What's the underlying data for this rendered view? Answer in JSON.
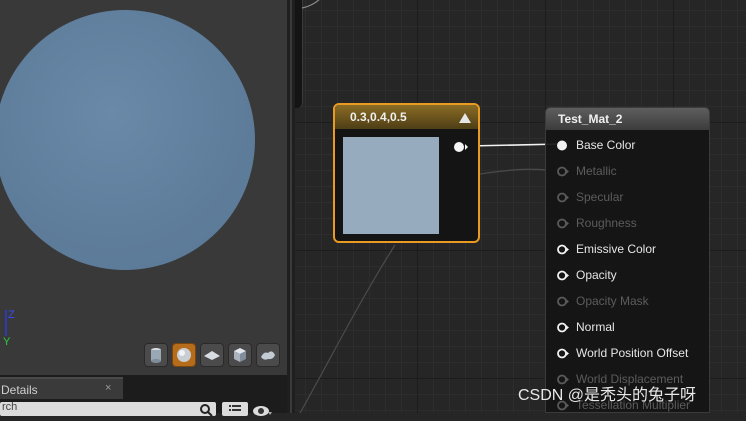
{
  "viewport": {
    "preview_buttons": [
      {
        "name": "cylinder-preview-icon",
        "active": false
      },
      {
        "name": "sphere-preview-icon",
        "active": true
      },
      {
        "name": "plane-preview-icon",
        "active": false
      },
      {
        "name": "cube-preview-icon",
        "active": false
      },
      {
        "name": "custom-mesh-preview-icon",
        "active": false
      }
    ],
    "axis_labels": {
      "z": "Z",
      "y": "Y"
    }
  },
  "details": {
    "tab_label": "Details",
    "close_glyph": "×",
    "search_value": "rch"
  },
  "graph": {
    "constant_node": {
      "title": "0.3,0.4,0.5",
      "swatch_color": "#96acbe"
    },
    "material_node": {
      "title": "Test_Mat_2",
      "pins": [
        {
          "label": "Base Color",
          "enabled": true,
          "connected": true
        },
        {
          "label": "Metallic",
          "enabled": false,
          "connected": false
        },
        {
          "label": "Specular",
          "enabled": false,
          "connected": false
        },
        {
          "label": "Roughness",
          "enabled": false,
          "connected": false
        },
        {
          "label": "Emissive Color",
          "enabled": true,
          "connected": false
        },
        {
          "label": "Opacity",
          "enabled": true,
          "connected": false
        },
        {
          "label": "Opacity Mask",
          "enabled": false,
          "connected": false
        },
        {
          "label": "Normal",
          "enabled": true,
          "connected": false
        },
        {
          "label": "World Position Offset",
          "enabled": true,
          "connected": false
        },
        {
          "label": "World Displacement",
          "enabled": false,
          "connected": false
        },
        {
          "label": "Tessellation Multiplier",
          "enabled": false,
          "connected": false
        }
      ]
    }
  },
  "watermark": "CSDN @是秃头的兔子呀",
  "colors": {
    "selected_border": "#e89a23",
    "sphere": "#5e7d9b"
  }
}
